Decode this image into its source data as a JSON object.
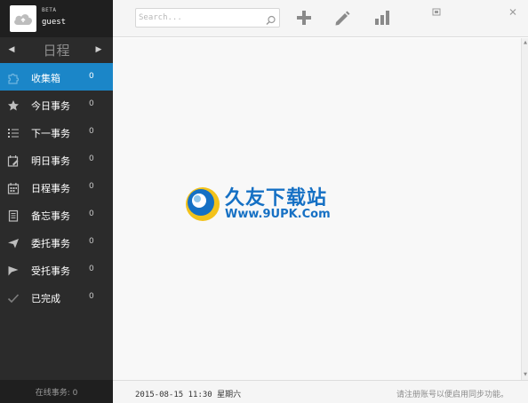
{
  "profile": {
    "badge": "BETA",
    "username": "guest"
  },
  "date_nav": {
    "title": "日程"
  },
  "nav": {
    "items": [
      {
        "label": "收集箱",
        "count": "0",
        "icon": "puzzle-icon"
      },
      {
        "label": "今日事务",
        "count": "0",
        "icon": "star-icon"
      },
      {
        "label": "下一事务",
        "count": "0",
        "icon": "list-icon"
      },
      {
        "label": "明日事务",
        "count": "0",
        "icon": "calendar-edit-icon"
      },
      {
        "label": "日程事务",
        "count": "0",
        "icon": "calendar-icon"
      },
      {
        "label": "备忘事务",
        "count": "0",
        "icon": "memo-icon"
      },
      {
        "label": "委托事务",
        "count": "0",
        "icon": "send-icon"
      },
      {
        "label": "受托事务",
        "count": "0",
        "icon": "flag-icon"
      },
      {
        "label": "已完成",
        "count": "0",
        "icon": "check-icon"
      }
    ],
    "active_index": 0
  },
  "footer": {
    "online_status": "在线事务: 0"
  },
  "toolbar": {
    "search_placeholder": "Search..."
  },
  "watermark": {
    "title": "久友下载站",
    "url": "Www.9UPK.Com"
  },
  "statusbar": {
    "datetime": "2015-08-15 11:30 星期六",
    "sync_hint": "请注册账号以便启用同步功能。"
  },
  "colors": {
    "sidebar_bg": "#2b2b2b",
    "active_item": "#1b86c8",
    "accent": "#1570c4"
  }
}
